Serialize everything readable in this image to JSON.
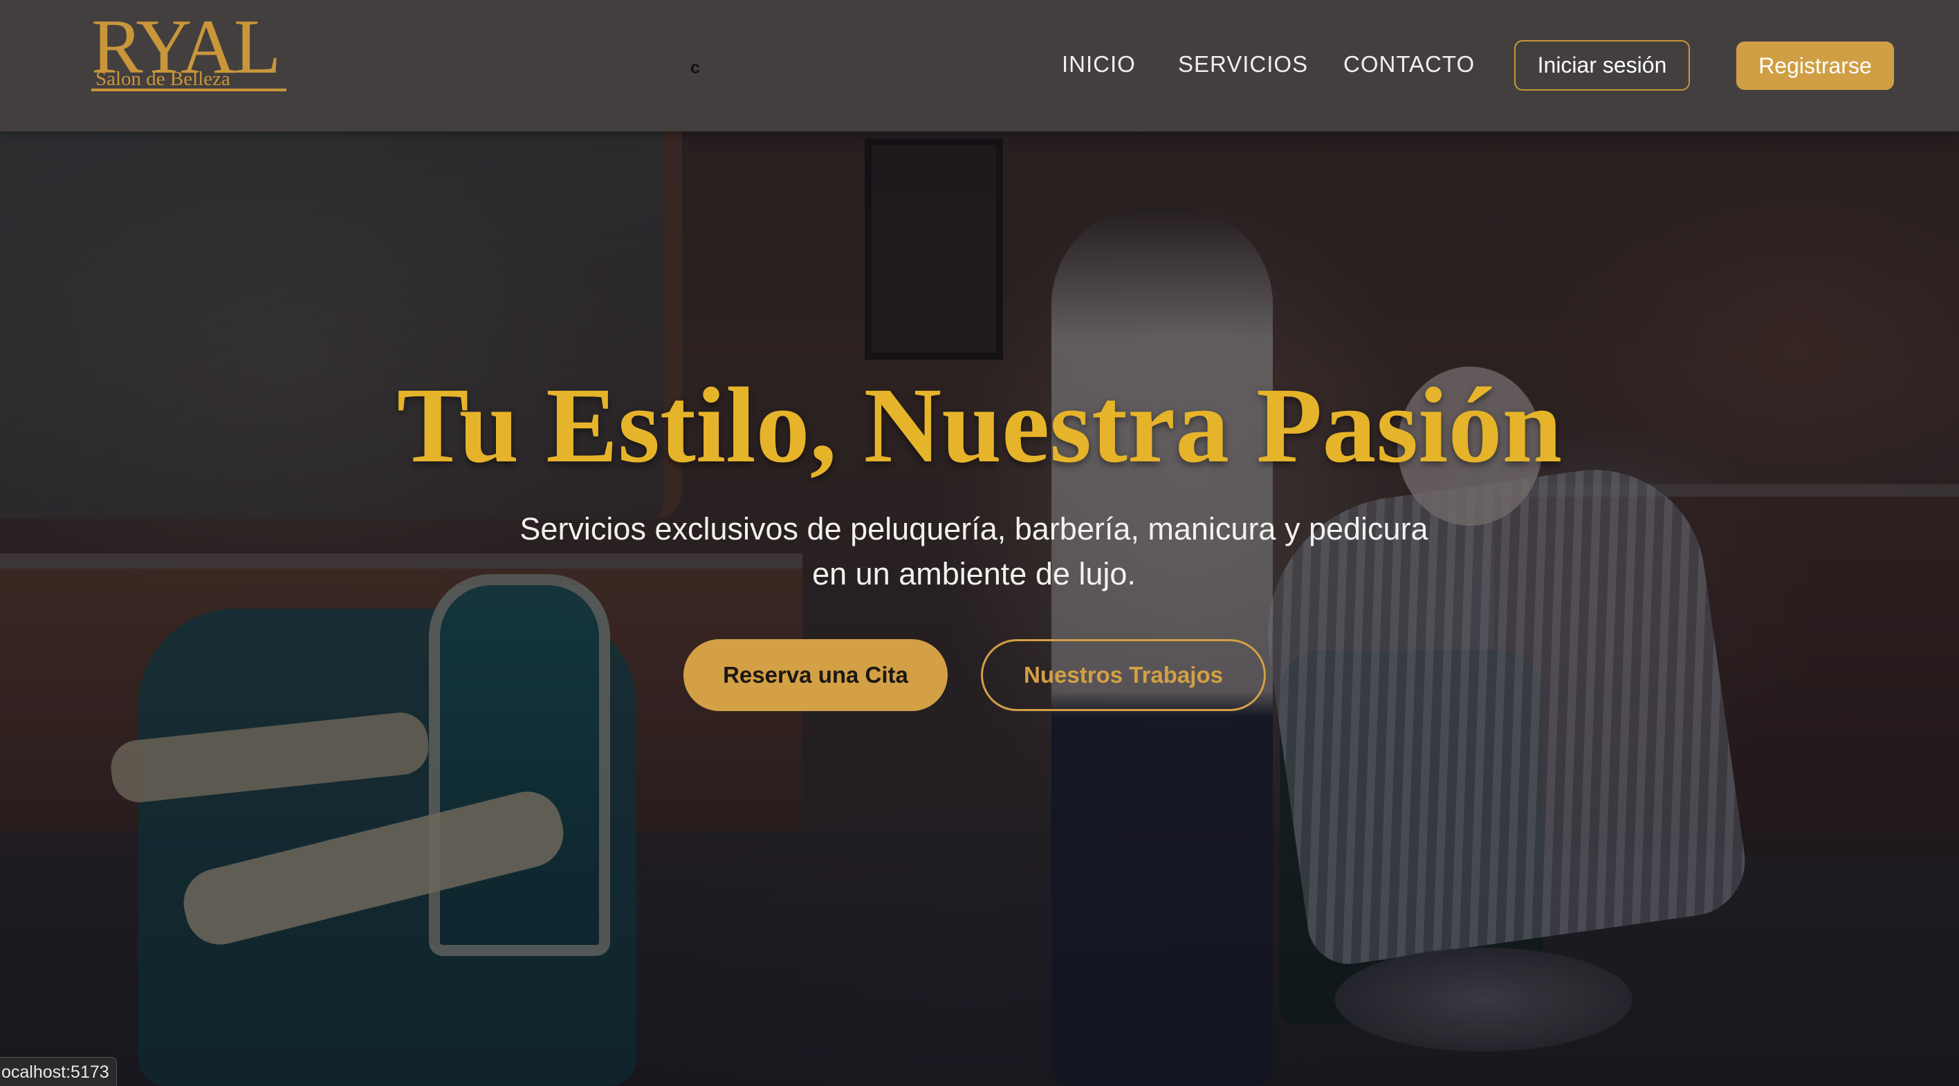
{
  "logo": {
    "wordmark": "RYAL",
    "tagline": "Salon de Belleza"
  },
  "navbar": {
    "stray_text": "c",
    "links": [
      {
        "label": "INICIO"
      },
      {
        "label": "SERVICIOS"
      },
      {
        "label": "CONTACTO"
      }
    ],
    "login_label": "Iniciar sesión",
    "register_label": "Registrarse"
  },
  "hero": {
    "title": "Tu Estilo, Nuestra Pasión",
    "subtitle_line1": "Servicios exclusivos de peluquería, barbería, manicura y pedicura",
    "subtitle_line2": "en un ambiente de lujo.",
    "primary_cta": "Reserva una Cita",
    "secondary_cta": "Nuestros Trabajos"
  },
  "status_bar": {
    "url": "ocalhost:5173"
  },
  "colors": {
    "accent_gold": "#d3a045",
    "title_gold": "#e6b42a",
    "navbar_bg": "#464242"
  }
}
